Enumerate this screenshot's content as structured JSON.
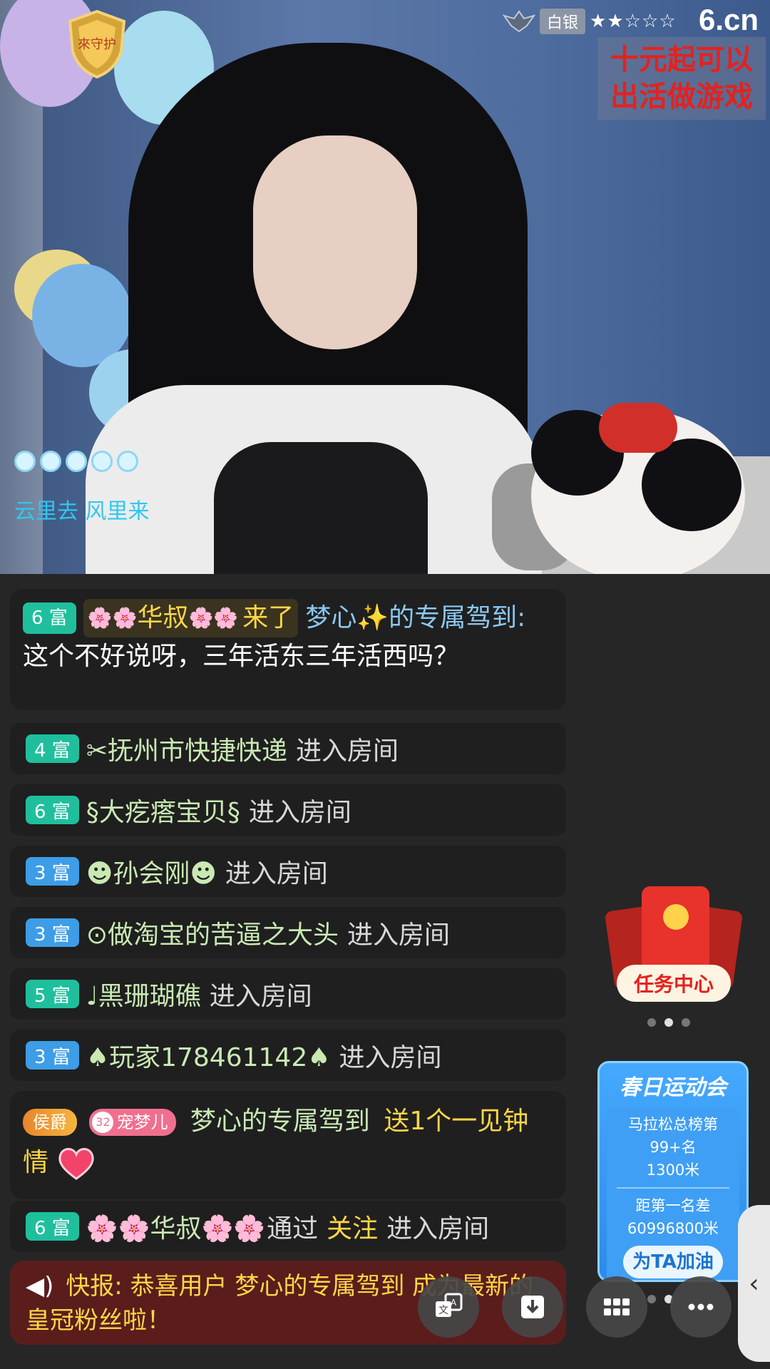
{
  "overlay": {
    "rank_label": "白银",
    "stars": "★★☆☆☆",
    "site_logo": "6.cn",
    "promo_line1": "十元起可以",
    "promo_line2": "出活做游戏",
    "shield_text": "來守护",
    "caption": "云里去 风里来"
  },
  "chat": {
    "first": {
      "level": "6 富",
      "prefix_flowers_left": "🌸🌸",
      "guest": "华叔",
      "prefix_flowers_right": "🌸🌸",
      "came": "来了",
      "user": "梦心✨的专属驾到:",
      "text": "这个不好说呀，三年活东三年活西吗？"
    },
    "rows": [
      {
        "level": "4 富",
        "name": "✂抚州市快捷快递",
        "action": "进入房间"
      },
      {
        "level": "6 富",
        "name": "§大疙瘩宝贝§",
        "action": "进入房间"
      },
      {
        "level": "3 富",
        "name": "☻孙会刚☻",
        "action": "进入房间"
      },
      {
        "level": "3 富",
        "name": "⊙做淘宝的苦逼之大头",
        "action": "进入房间"
      },
      {
        "level": "5 富",
        "name": "♩黑珊瑚礁",
        "action": "进入房间"
      },
      {
        "level": "3 富",
        "name": "♠玩家178461142♠",
        "action": "进入房间"
      }
    ],
    "gift": {
      "badge1": "侯爵",
      "badge2_num": "32",
      "badge2": "宠梦儿",
      "user": "梦心的专属驾到",
      "action": "送1个一见钟情"
    },
    "follow": {
      "level": "6 富",
      "name": "🌸🌸华叔🌸🌸",
      "via": "通过",
      "follow": "关注",
      "action": "进入房间"
    }
  },
  "news": {
    "label": "快报:",
    "text": "恭喜用户 梦心的专属驾到 成为最新的皇冠粉丝啦！"
  },
  "task_center": {
    "label": "任务中心"
  },
  "sports": {
    "title": "春日运动会",
    "rank_text": "马拉松总榜第99+名",
    "distance": "1300米",
    "gap_label": "距第一名差",
    "gap_value": "60996800米",
    "button": "为TA加油"
  },
  "colors": {
    "teal_level": "#1fbf9d",
    "blue_level": "#3d9de6",
    "highlight": "#ffd646",
    "news_bg": "#5a1d1c"
  }
}
